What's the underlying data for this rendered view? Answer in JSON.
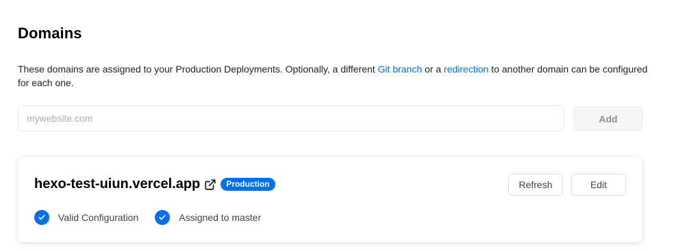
{
  "section": {
    "title": "Domains",
    "description_parts": {
      "before": "These domains are assigned to your Production Deployments. Optionally, a different ",
      "link1": "Git branch",
      "middle": " or a ",
      "link2": "redirection",
      "after": " to another domain can be configured for each one."
    }
  },
  "add_form": {
    "placeholder": "mywebsite.com",
    "value": "",
    "button_label": "Add"
  },
  "domain_card": {
    "domain": "hexo-test-uiun.vercel.app",
    "external_link_icon": "external-link-icon",
    "badge": "Production",
    "refresh_label": "Refresh",
    "edit_label": "Edit",
    "statuses": [
      {
        "icon": "check-circle-icon",
        "label": "Valid Configuration"
      },
      {
        "icon": "check-circle-icon",
        "label": "Assigned to master"
      }
    ]
  },
  "colors": {
    "accent": "#0070f3",
    "text": "#111111",
    "muted": "#444444",
    "border": "#eaeaea"
  }
}
